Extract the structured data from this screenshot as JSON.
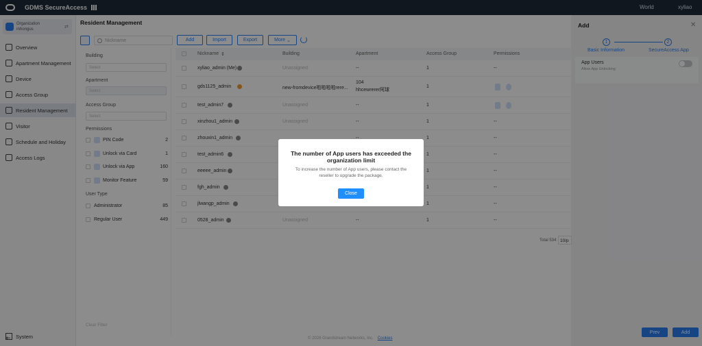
{
  "topbar": {
    "app_name": "GDMS SecureAccess",
    "region": "World",
    "user": "xyliao"
  },
  "org": {
    "label": "Organization",
    "name": "mhongus"
  },
  "nav": [
    {
      "label": "Overview",
      "icon": "overview-icon"
    },
    {
      "label": "Apartment Management",
      "icon": "apartment-icon"
    },
    {
      "label": "Device",
      "icon": "device-icon"
    },
    {
      "label": "Access Group",
      "icon": "access-group-icon"
    },
    {
      "label": "Resident Management",
      "icon": "resident-icon"
    },
    {
      "label": "Visitor",
      "icon": "visitor-icon"
    },
    {
      "label": "Schedule and Holiday",
      "icon": "schedule-icon"
    },
    {
      "label": "Access Logs",
      "icon": "logs-icon"
    }
  ],
  "system": {
    "label": "System"
  },
  "page": {
    "title": "Resident Management",
    "search_placeholder": "Nickname",
    "buttons": {
      "add": "Add",
      "import": "Import",
      "export": "Export",
      "more": "More"
    }
  },
  "filters": {
    "building_label": "Building",
    "building_select": "Select",
    "apartment_label": "Apartment",
    "apartment_select": "Select",
    "access_group_label": "Access Group",
    "access_group_select": "Select",
    "permissions_label": "Permissions",
    "permissions": [
      {
        "label": "PIN Code",
        "count": "2"
      },
      {
        "label": "Unlock via Card",
        "count": "1"
      },
      {
        "label": "Unlock via App",
        "count": "160"
      },
      {
        "label": "Monitor Feature",
        "count": "59"
      }
    ],
    "user_type_label": "User Type",
    "user_types": [
      {
        "label": "Administrator",
        "count": "85"
      },
      {
        "label": "Regular User",
        "count": "449"
      }
    ],
    "clear": "Clear Filter"
  },
  "table": {
    "headers": {
      "nickname": "Nickname",
      "building": "Building",
      "apartment": "Apartment",
      "access_group": "Access Group",
      "permissions": "Permissions"
    },
    "rows": [
      {
        "nickname": "xyliao_admin (Me)",
        "building": "Unassigned",
        "apartment": "--",
        "group": "1",
        "perm": "--"
      },
      {
        "nickname": "gds1125_admin",
        "building": "new-fromdevice啦啦啦啦rere...",
        "apartment": "104",
        "apartment2": "hhcewrerer阿球",
        "group": "1",
        "perm": ""
      },
      {
        "nickname": "test_admin7",
        "building": "Unassigned",
        "apartment": "--",
        "group": "1",
        "perm": ""
      },
      {
        "nickname": "xinzhou1_admin",
        "building": "Unassigned",
        "apartment": "--",
        "group": "1",
        "perm": "--"
      },
      {
        "nickname": "zhouxin1_admin",
        "building": "",
        "apartment": "--",
        "group": "1",
        "perm": "--"
      },
      {
        "nickname": "test_admin6",
        "building": "",
        "apartment": "",
        "group": "1",
        "perm": "--"
      },
      {
        "nickname": "eeeee_admin",
        "building": "",
        "apartment": "",
        "group": "1",
        "perm": "--"
      },
      {
        "nickname": "fgh_admin",
        "building": "",
        "apartment": "",
        "group": "1",
        "perm": "--"
      },
      {
        "nickname": "jlwangp_admin",
        "building": "",
        "apartment": "",
        "group": "1",
        "perm": "--"
      },
      {
        "nickname": "0528_admin",
        "building": "Unassigned",
        "apartment": "--",
        "group": "1",
        "perm": "--"
      }
    ],
    "total": "Total 534",
    "page_size": "10/p"
  },
  "footer": {
    "copyright": "© 2026 Grandstream Networks, Inc.",
    "cookies": "Cookies"
  },
  "drawer": {
    "title": "Add",
    "steps": [
      {
        "num": "1",
        "label": "Basic Information"
      },
      {
        "num": "2",
        "label": "SecureAccess App"
      }
    ],
    "app_users_title": "App Users",
    "app_users_sub": "Allow App Unlocking",
    "app_users_enabled": false,
    "prev": "Prev",
    "add": "Add"
  },
  "modal": {
    "title": "The number of App users has exceeded the organization limit",
    "body": "To increase the number of App users, please contact the reseller to upgrade the package.",
    "close": "Close"
  },
  "colors": {
    "accent": "#2a7ff0",
    "topbar": "#1e2a3a",
    "warn": "#f39c33"
  }
}
